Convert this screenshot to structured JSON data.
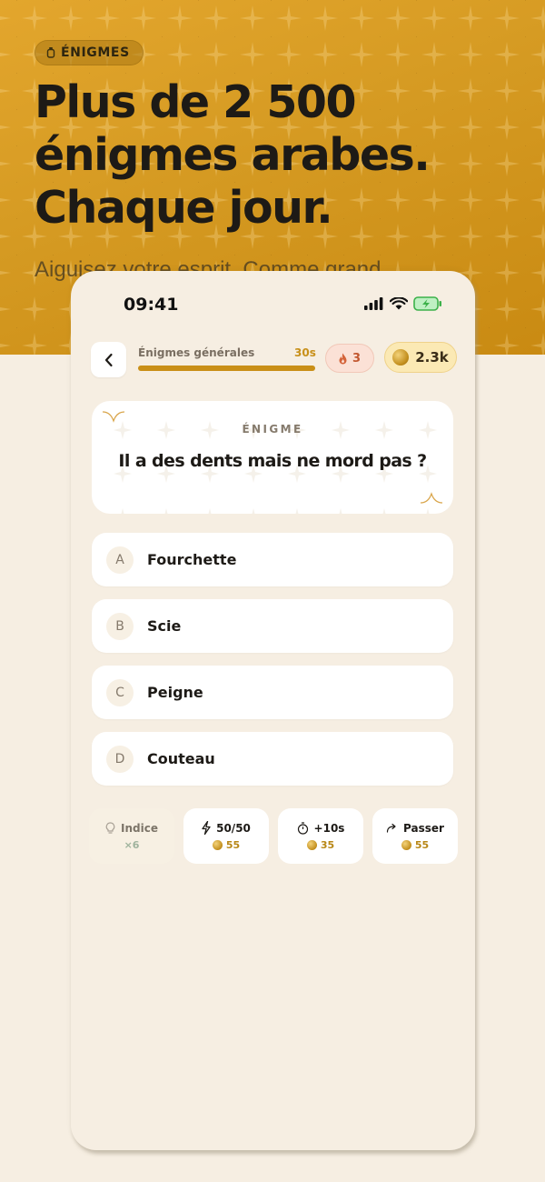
{
  "hero": {
    "badge": "ÉNIGMES",
    "headline": [
      "Plus de 2 500",
      "énigmes arabes.",
      "Chaque jour."
    ],
    "subtitle": "Aiguisez votre esprit. Comme grand"
  },
  "status_bar": {
    "time": "09:41"
  },
  "game": {
    "category": "Énigmes générales",
    "timer": "30s",
    "progress_fraction": 1.0,
    "streak": "3",
    "coins": "2.3k"
  },
  "riddle": {
    "kicker": "ÉNIGME",
    "question": "Il a des dents mais ne mord pas ?"
  },
  "answers": [
    {
      "letter": "A",
      "text": "Fourchette"
    },
    {
      "letter": "B",
      "text": "Scie"
    },
    {
      "letter": "C",
      "text": "Peigne"
    },
    {
      "letter": "D",
      "text": "Couteau"
    }
  ],
  "powerups": [
    {
      "icon": "lightbulb-icon",
      "label": "Indice",
      "sub": "×6",
      "enabled": false
    },
    {
      "icon": "lightning-icon",
      "label": "50/50",
      "cost": "55",
      "enabled": true
    },
    {
      "icon": "stopwatch-icon",
      "label": "+10s",
      "cost": "35",
      "enabled": true
    },
    {
      "icon": "skip-arrow-icon",
      "label": "Passer",
      "cost": "55",
      "enabled": true
    }
  ],
  "colors": {
    "hero_gold": "#d59a22",
    "background": "#f6eee2",
    "accent": "#c98f17",
    "streak": "#c2572f"
  }
}
